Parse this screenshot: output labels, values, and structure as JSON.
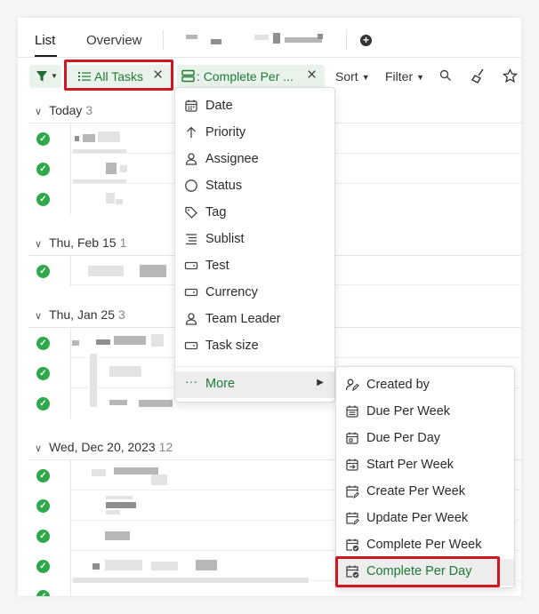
{
  "tabs": [
    {
      "label": "List",
      "active": true
    },
    {
      "label": "Overview",
      "active": false
    }
  ],
  "toolbar": {
    "filter_chip": "All Tasks",
    "group_chip": ": Complete Per ...",
    "sort_label": "Sort",
    "filter_label": "Filter"
  },
  "groups": [
    {
      "label": "Today",
      "count": "3"
    },
    {
      "label": "Thu, Feb 15",
      "count": "1"
    },
    {
      "label": "Thu, Jan 25",
      "count": "3"
    },
    {
      "label": "Wed, Dec 20, 2023",
      "count": "12"
    }
  ],
  "group_menu": {
    "items": [
      {
        "label": "Date",
        "icon": "calendar-icon"
      },
      {
        "label": "Priority",
        "icon": "arrow-up-icon"
      },
      {
        "label": "Assignee",
        "icon": "person-icon"
      },
      {
        "label": "Status",
        "icon": "circle-icon"
      },
      {
        "label": "Tag",
        "icon": "tag-icon"
      },
      {
        "label": "Sublist",
        "icon": "sublist-icon"
      },
      {
        "label": "Test",
        "icon": "field-icon"
      },
      {
        "label": "Currency",
        "icon": "field-icon"
      },
      {
        "label": "Team Leader",
        "icon": "person-icon"
      },
      {
        "label": "Task size",
        "icon": "field-icon"
      }
    ],
    "more_label": "More"
  },
  "more_menu": {
    "items": [
      {
        "label": "Created by",
        "icon": "person-edit-icon"
      },
      {
        "label": "Due Per Week",
        "icon": "calendar-week-icon"
      },
      {
        "label": "Due Per Day",
        "icon": "calendar-day-icon"
      },
      {
        "label": "Start Per Week",
        "icon": "calendar-start-icon"
      },
      {
        "label": "Create Per Week",
        "icon": "calendar-edit-icon"
      },
      {
        "label": "Update Per Week",
        "icon": "calendar-edit-icon"
      },
      {
        "label": "Complete Per Week",
        "icon": "calendar-check-icon"
      },
      {
        "label": "Complete Per Day",
        "icon": "calendar-check-icon"
      }
    ],
    "selected": "Complete Per Day"
  },
  "colors": {
    "accent_green": "#1f7a35",
    "chip_bg": "#eaf3eb",
    "check_green": "#2ea94a",
    "highlight_red": "#d0161f"
  }
}
